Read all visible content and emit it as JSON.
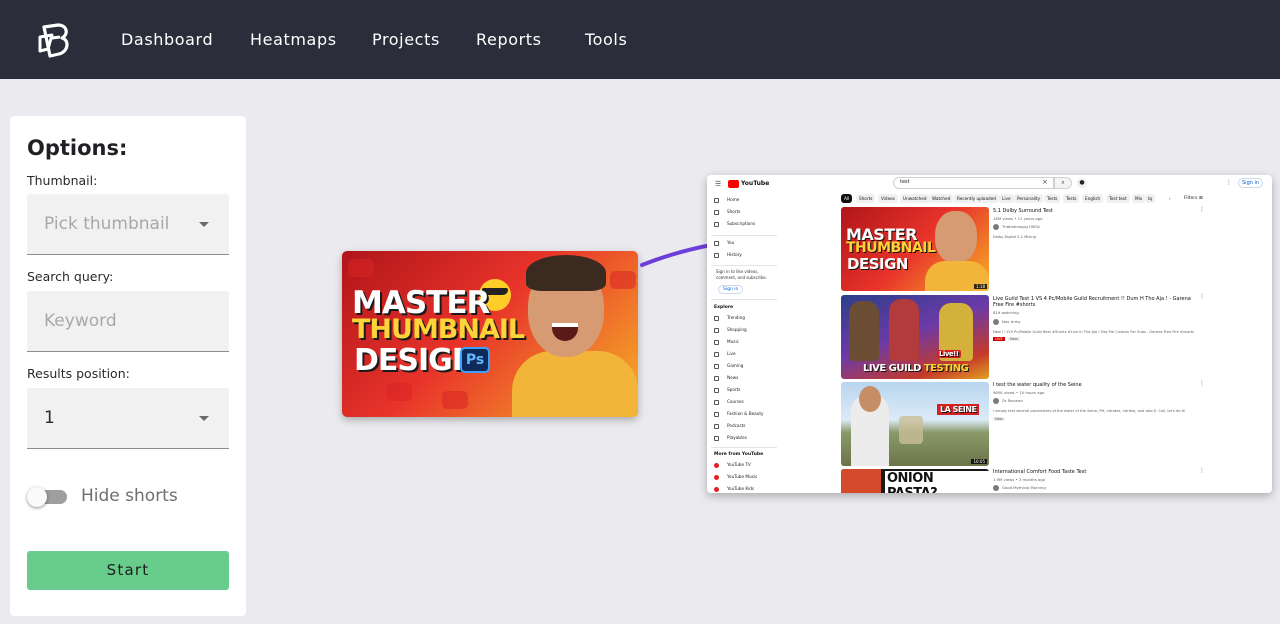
{
  "nav": {
    "items": [
      {
        "label": "Dashboard"
      },
      {
        "label": "Heatmaps"
      },
      {
        "label": "Projects"
      },
      {
        "label": "Reports"
      },
      {
        "label": "Tools"
      }
    ]
  },
  "options": {
    "title": "Options:",
    "thumbnail_label": "Thumbnail:",
    "thumbnail_placeholder": "Pick thumbnail",
    "search_label": "Search query:",
    "search_placeholder": "Keyword",
    "position_label": "Results position:",
    "position_value": "1",
    "hide_shorts_label": "Hide shorts",
    "hide_shorts_on": false,
    "start_label": "Start"
  },
  "thumbnail": {
    "line1": "MASTER",
    "line2": "THUMBNAIL",
    "line3": "DESIGN",
    "badge": "Ps"
  },
  "colors": {
    "topbar": "#2b2d3b",
    "accent_green": "#67cc8c",
    "arrow": "#6b3fd8",
    "youtube_red": "#ff0000"
  },
  "youtube": {
    "logo": "YouTube",
    "search_value": "test",
    "signin": "Sign in",
    "sidebar": {
      "items": [
        "Home",
        "Shorts",
        "Subscriptions",
        "You",
        "History"
      ],
      "note": "Sign in to like videos, comment, and subscribe.",
      "signin": "Sign in",
      "explore_title": "Explore",
      "explore": [
        "Trending",
        "Shopping",
        "Music",
        "Live",
        "Gaming",
        "News",
        "Sports",
        "Courses",
        "Fashion & Beauty",
        "Podcasts",
        "Playables"
      ],
      "more_title": "More from YouTube",
      "more": [
        "YouTube TV",
        "YouTube Music",
        "YouTube Kids"
      ]
    },
    "chips": [
      "All",
      "Shorts",
      "Videos",
      "Unwatched",
      "Watched",
      "Recently uploaded",
      "Live",
      "Personality",
      "Tests",
      "Tests",
      "English",
      "Test test",
      "Mix",
      "Iq"
    ],
    "filters": "Filters",
    "results": [
      {
        "title": "5.1 Dolby Surround Test",
        "meta": "18M views • 11 years ago",
        "channel": "Thatlatinoguy1983z",
        "desc": "Dolby Digital 5.1 Mixing",
        "duration": "1:18"
      },
      {
        "title": "Live Guild Test 1 VS 4 Pc/Mobile Guild Recruitment !! Dum H Tho Aja ! - Garena Free Fire #shorts",
        "meta": "819 watching",
        "channel": "Nax Army",
        "desc": "New !! 1V4 Pc/Mobile Guild Best #Shorts #Live in The Aja ! Day Pai Custom For Subs - Garena Free Fire #shorts",
        "badge": "LIVE",
        "badge2": "New",
        "thumb_text1": "LIVE GUILD",
        "thumb_text2": "TESTING",
        "thumb_live": "Live!!"
      },
      {
        "title": "I test the water quality of the Seine",
        "meta": "985K views • 10 hours ago",
        "channel": "Dr Rosman",
        "desc": "I simply test several parameters of the water of the Seine, PH, nitrates, nitrites, and also E. Coli, let's do it!",
        "badge2": "New",
        "duration": "10:05",
        "thumb_text": "LA SEINE"
      },
      {
        "title": "International Comfort Food Taste Test",
        "meta": "1.9M views • 3 months ago",
        "channel": "Good Mythical Morning",
        "thumb_text": "ONION PASTA?"
      }
    ]
  }
}
